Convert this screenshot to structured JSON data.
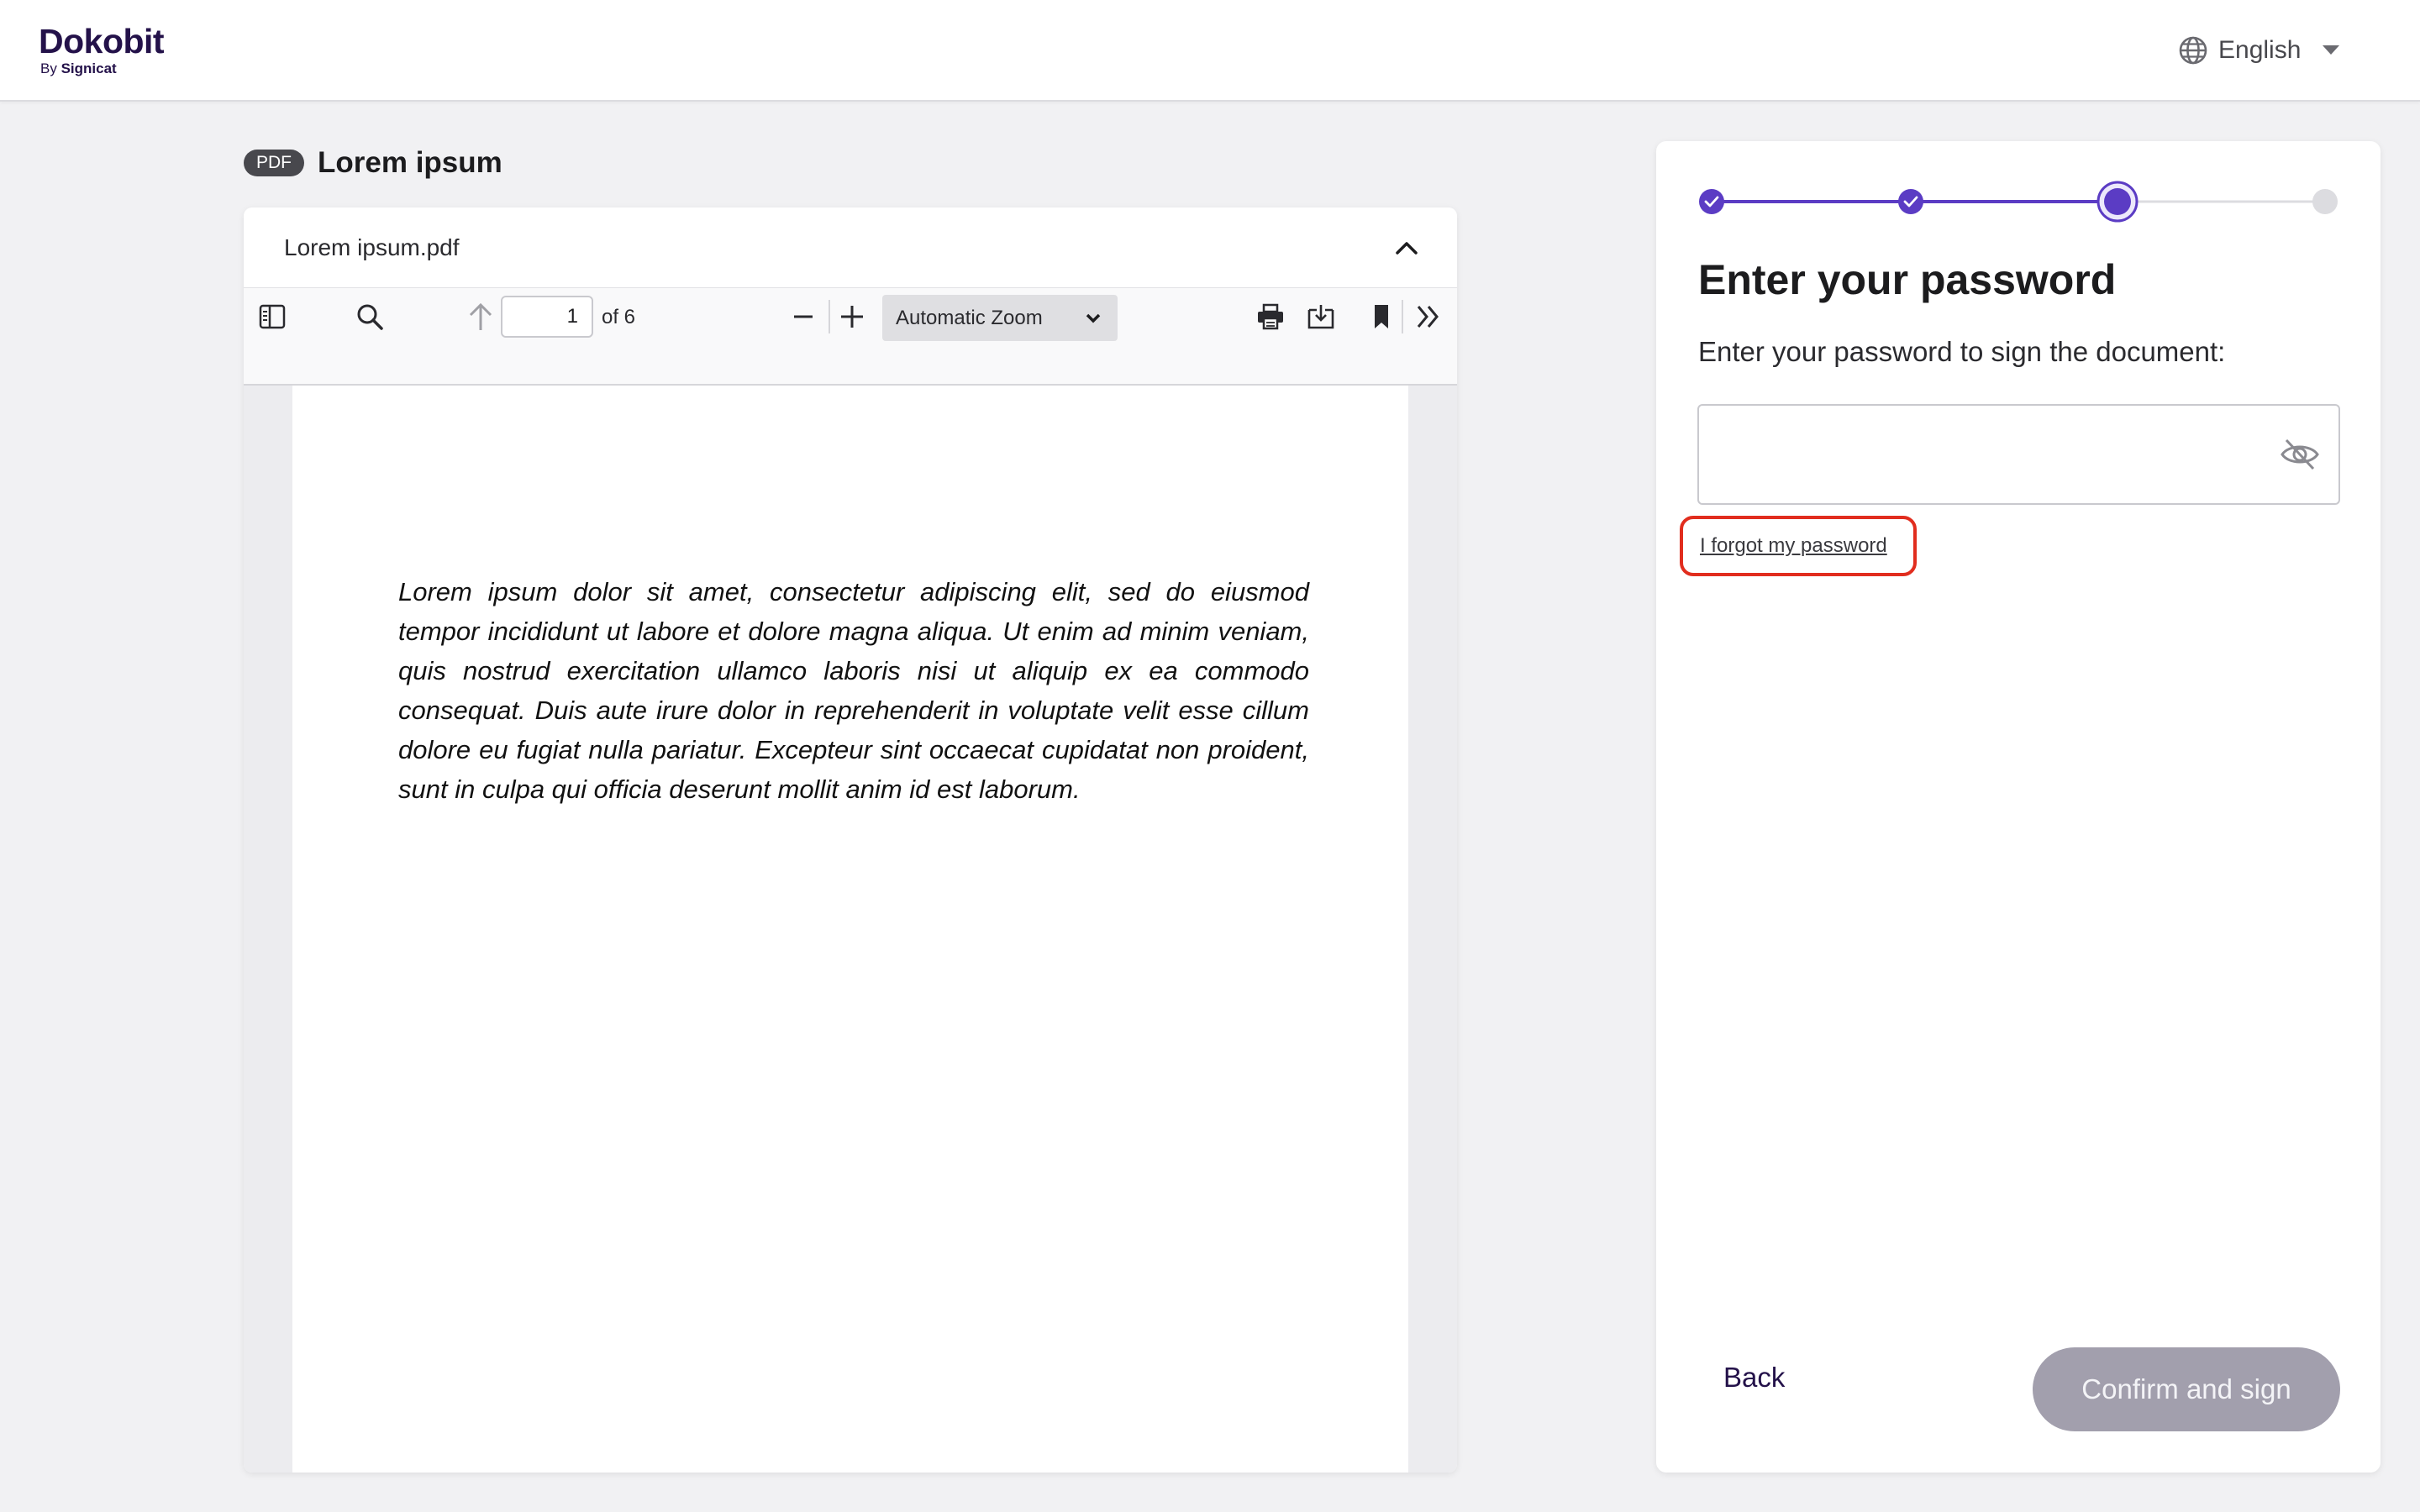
{
  "header": {
    "logo_main": "Dokobit",
    "logo_by": "By",
    "logo_company": "Signicat",
    "language": "English"
  },
  "document": {
    "badge": "PDF",
    "title": "Lorem ipsum",
    "file_name": "Lorem ipsum.pdf"
  },
  "pdf_toolbar": {
    "page_number": "1",
    "page_of": "of 6",
    "zoom": "Automatic Zoom"
  },
  "pdf_page": {
    "text": "Lorem ipsum dolor sit amet, consectetur adipiscing elit, sed do eiusmod tempor incididunt ut labore et dolore magna aliqua. Ut enim ad minim veniam, quis nostrud exercitation ullamco laboris nisi ut aliquip ex ea commodo consequat. Duis aute irure dolor in reprehenderit in voluptate velit esse cillum dolore eu fugiat nulla pariatur. Excepteur sint occaecat cupidatat non proident, sunt in culpa qui officia deserunt mollit anim id est laborum."
  },
  "stepper": {
    "total_steps": 4,
    "current_step": 3,
    "completed_steps": 2
  },
  "sign_panel": {
    "title": "Enter your password",
    "description": "Enter your password to sign the document:",
    "password_value": "",
    "forgot_link": "I forgot my password",
    "back_label": "Back",
    "confirm_label": "Confirm and sign"
  },
  "colors": {
    "brand": "#24124a",
    "accent": "#5b3cc4",
    "highlight": "#e12d1e",
    "disabled_button": "#a29fad"
  }
}
